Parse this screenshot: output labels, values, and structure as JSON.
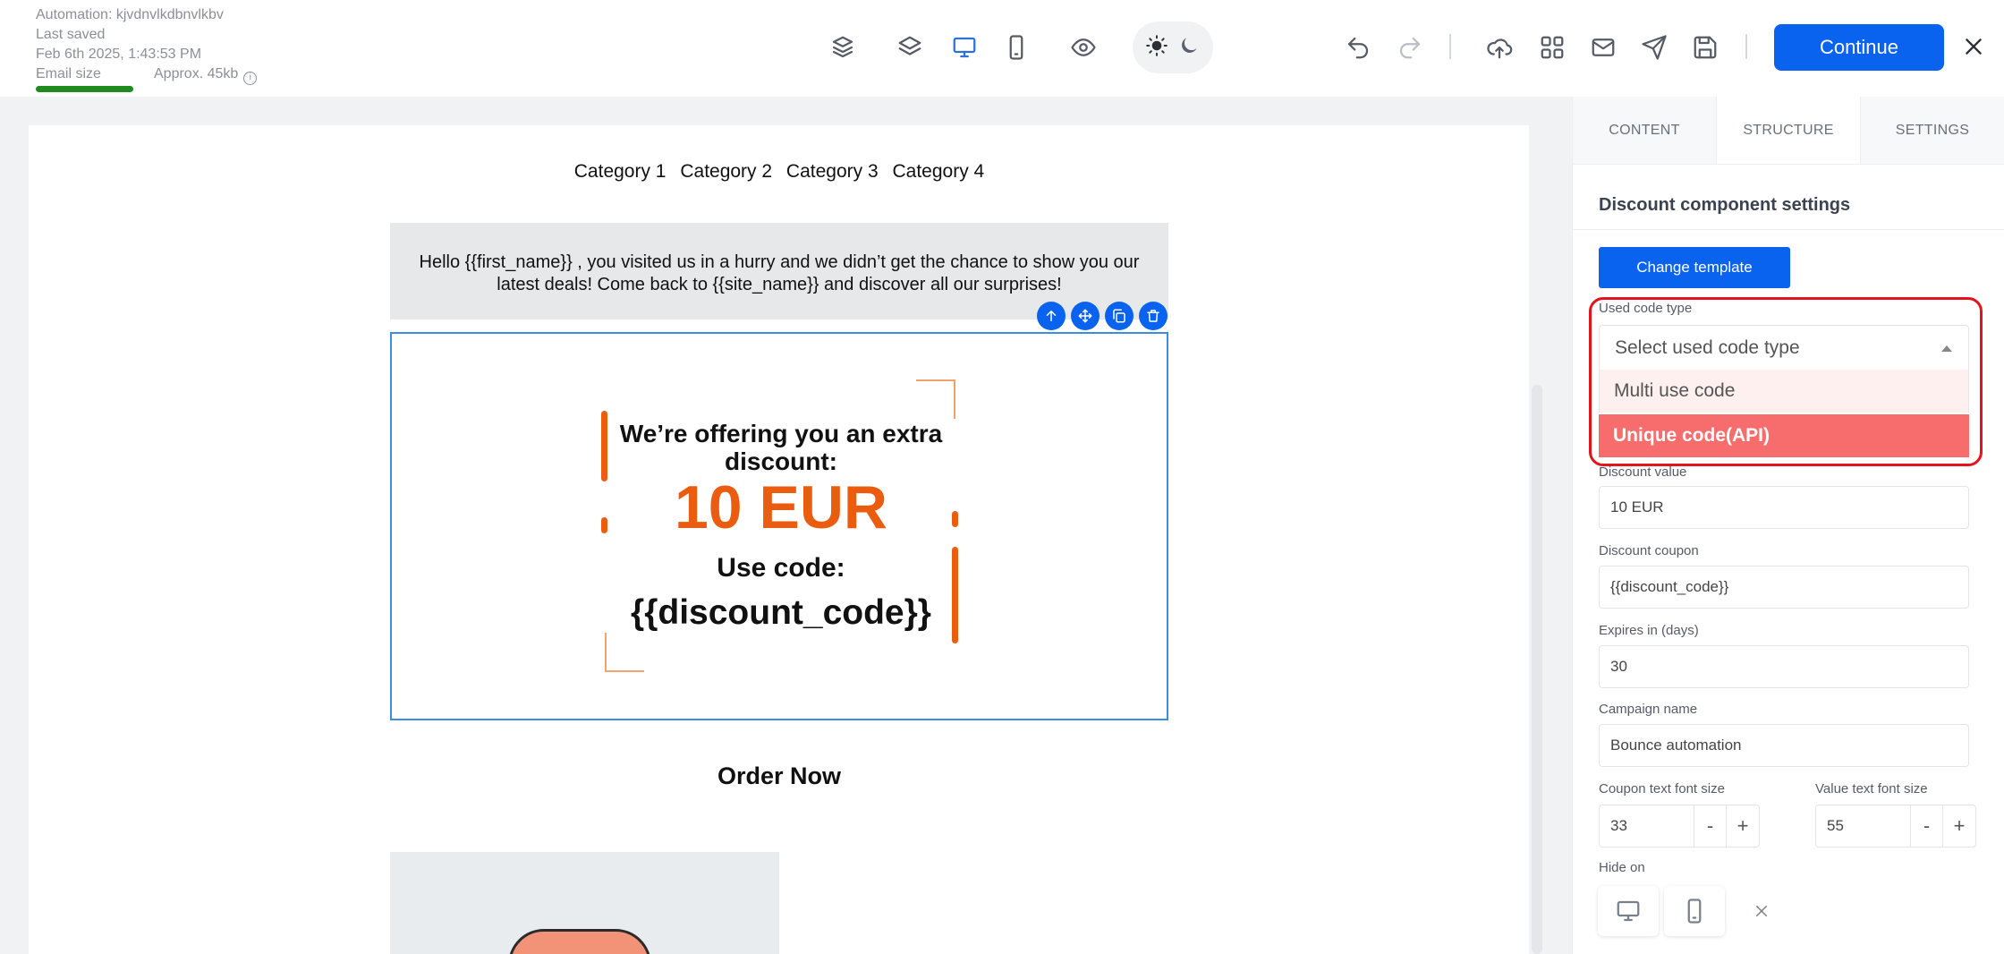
{
  "header": {
    "automation": "Automation: kjvdnvlkdbnvlkbv",
    "saved_label": "Last saved",
    "saved_time": "Feb 6th 2025, 1:43:53 PM",
    "email_size_label": "Email size",
    "approx_size": "Approx. 45kb",
    "email_size_fill": 1.0,
    "continue_label": "Continue"
  },
  "toolbar_icons": [
    "layers-alt-icon",
    "layers-icon",
    "desktop-icon",
    "mobile-icon",
    "eye-icon",
    "sun-icon",
    "moon-icon",
    "undo-icon",
    "redo-icon",
    "upload-icon",
    "grid-icon",
    "mail-icon",
    "send-icon",
    "save-icon",
    "close-icon"
  ],
  "email": {
    "categories": [
      "Category 1",
      "Category 2",
      "Category 3",
      "Category 4"
    ],
    "greeting": "Hello {{first_name}}  , you visited us in a hurry and we didn’t get the chance to show you our latest deals! Come back to {{site_name}} and discover all our surprises!",
    "offer_line": "We’re offering you an extra discount:",
    "discount_value": "10 EUR",
    "use_code_label": "Use code:",
    "discount_code": "{{discount_code}}",
    "order_now": "Order Now"
  },
  "panel": {
    "tabs": [
      "CONTENT",
      "STRUCTURE",
      "SETTINGS"
    ],
    "title": "Discount component settings",
    "change_template": "Change template",
    "used_code_type_label": "Used code type",
    "used_code_type_placeholder": "Select used code type",
    "code_type_options": [
      "Multi use code",
      "Unique code(API)"
    ],
    "highlighted_option": "Unique code(API)",
    "discount_value_label": "Discount value",
    "discount_value": "10 EUR",
    "discount_coupon_label": "Discount coupon",
    "discount_coupon": "{{discount_code}}",
    "expires_label": "Expires in (days)",
    "expires_value": "30",
    "campaign_label": "Campaign name",
    "campaign_value": "Bounce automation",
    "coupon_font_label": "Coupon text font size",
    "coupon_font_value": "33",
    "value_font_label": "Value text font size",
    "value_font_value": "55",
    "stepper_minus": "-",
    "stepper_plus": "+",
    "hide_on_label": "Hide on"
  },
  "colors": {
    "accent": "#0a63ef",
    "discount": "#ea5d10",
    "highlight": "#e3141d",
    "selected_option": "#f76c6c",
    "progress": "#1f8a1f"
  }
}
